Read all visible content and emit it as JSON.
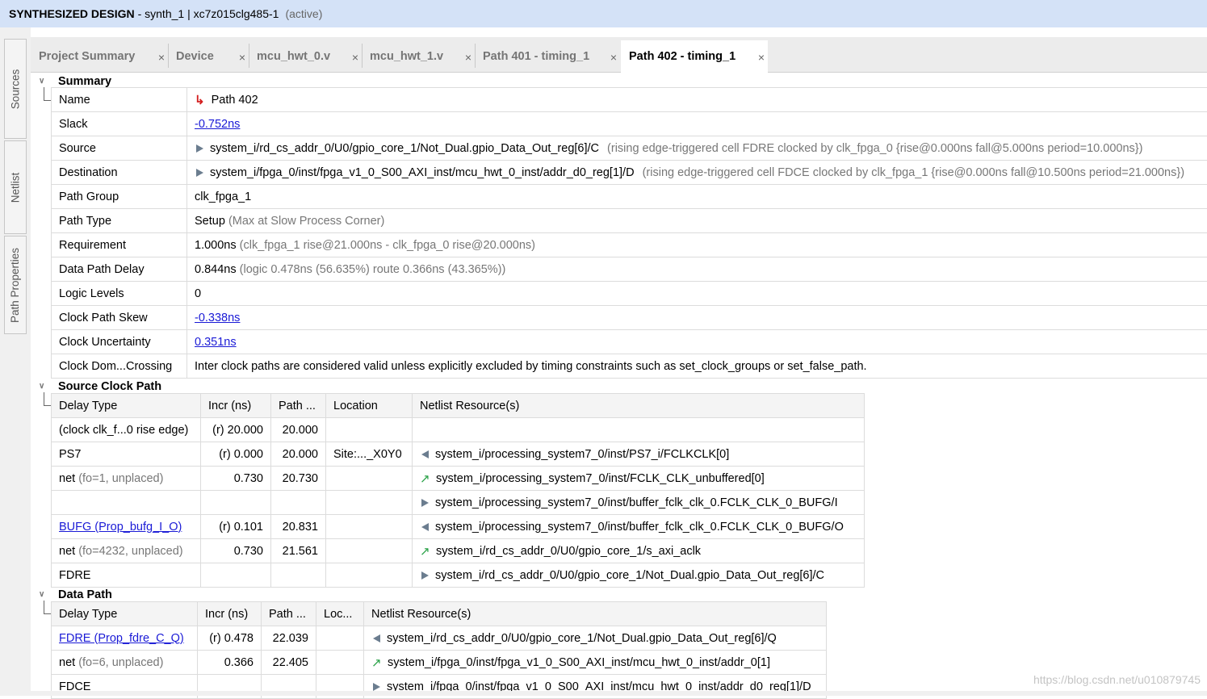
{
  "title": {
    "design": "SYNTHESIZED DESIGN",
    "detail": "- synth_1 | xc7z015clg485-1",
    "state": "(active)"
  },
  "side_tabs": [
    "Sources",
    "Netlist",
    "Path Properties"
  ],
  "tabs": [
    {
      "label": "Project Summary"
    },
    {
      "label": "Device"
    },
    {
      "label": "mcu_hwt_0.v"
    },
    {
      "label": "mcu_hwt_1.v"
    },
    {
      "label": "Path 401 - timing_1"
    },
    {
      "label": "Path 402 - timing_1"
    }
  ],
  "close_glyph": "×",
  "summary": {
    "header": "Summary",
    "name_label": "Name",
    "name_value": "Path 402",
    "slack_label": "Slack",
    "slack_value": "-0.752ns",
    "source_label": "Source",
    "source_value": "system_i/rd_cs_addr_0/U0/gpio_core_1/Not_Dual.gpio_Data_Out_reg[6]/C",
    "source_note": "(rising edge-triggered cell FDRE clocked by clk_fpga_0  {rise@0.000ns fall@5.000ns period=10.000ns})",
    "dest_label": "Destination",
    "dest_value": "system_i/fpga_0/inst/fpga_v1_0_S00_AXI_inst/mcu_hwt_0_inst/addr_d0_reg[1]/D",
    "dest_note": "(rising edge-triggered cell FDCE clocked by clk_fpga_1  {rise@0.000ns fall@10.500ns period=21.000ns})",
    "group_label": "Path Group",
    "group_value": "clk_fpga_1",
    "type_label": "Path Type",
    "type_value": "Setup",
    "type_note": "(Max at Slow Process Corner)",
    "req_label": "Requirement",
    "req_value": "1.000ns",
    "req_note": "(clk_fpga_1 rise@21.000ns - clk_fpga_0 rise@20.000ns)",
    "dpd_label": "Data Path Delay",
    "dpd_value": "0.844ns",
    "dpd_note": "(logic 0.478ns (56.635%)  route 0.366ns (43.365%))",
    "ll_label": "Logic Levels",
    "ll_value": "0",
    "skew_label": "Clock Path Skew",
    "skew_value": "-0.338ns",
    "unc_label": "Clock Uncertainty",
    "unc_value": "0.351ns",
    "cdc_label": "Clock Dom...Crossing",
    "cdc_value": "Inter clock paths are considered valid unless explicitly excluded by timing constraints such as set_clock_groups or set_false_path."
  },
  "source_clock": {
    "header": "Source Clock Path",
    "columns": [
      "Delay Type",
      "Incr (ns)",
      "Path ...",
      "Location",
      "Netlist Resource(s)"
    ],
    "rows": [
      {
        "type": "(clock clk_f...0 rise edge)",
        "note": "",
        "incr": "(r) 20.000",
        "path": "20.000",
        "loc": "",
        "res": ""
      },
      {
        "type": "PS7",
        "note": "",
        "incr": "(r) 0.000",
        "path": "20.000",
        "loc": "Site:..._X0Y0",
        "res": "system_i/processing_system7_0/inst/PS7_i/FCLKCLK[0]"
      },
      {
        "type": "net",
        "note": "(fo=1, unplaced)",
        "incr": "0.730",
        "path": "20.730",
        "loc": "",
        "res": "system_i/processing_system7_0/inst/FCLK_CLK_unbuffered[0]"
      },
      {
        "type": "",
        "note": "",
        "incr": "",
        "path": "",
        "loc": "",
        "res": "system_i/processing_system7_0/inst/buffer_fclk_clk_0.FCLK_CLK_0_BUFG/I"
      },
      {
        "type": "BUFG (Prop_bufg_I_O)",
        "note": "",
        "incr": "(r) 0.101",
        "path": "20.831",
        "loc": "",
        "res": "system_i/processing_system7_0/inst/buffer_fclk_clk_0.FCLK_CLK_0_BUFG/O"
      },
      {
        "type": "net",
        "note": "(fo=4232, unplaced)",
        "incr": "0.730",
        "path": "21.561",
        "loc": "",
        "res": "system_i/rd_cs_addr_0/U0/gpio_core_1/s_axi_aclk"
      },
      {
        "type": "FDRE",
        "note": "",
        "incr": "",
        "path": "",
        "loc": "",
        "res": "system_i/rd_cs_addr_0/U0/gpio_core_1/Not_Dual.gpio_Data_Out_reg[6]/C"
      }
    ]
  },
  "data_path": {
    "header": "Data Path",
    "columns": [
      "Delay Type",
      "Incr (ns)",
      "Path ...",
      "Loc...",
      "Netlist Resource(s)"
    ],
    "rows": [
      {
        "type": "FDRE (Prop_fdre_C_Q)",
        "note": "",
        "incr": "(r) 0.478",
        "path": "22.039",
        "loc": "",
        "res": "system_i/rd_cs_addr_0/U0/gpio_core_1/Not_Dual.gpio_Data_Out_reg[6]/Q"
      },
      {
        "type": "net",
        "note": "(fo=6, unplaced)",
        "incr": "0.366",
        "path": "22.405",
        "loc": "",
        "res": "system_i/fpga_0/inst/fpga_v1_0_S00_AXI_inst/mcu_hwt_0_inst/addr_0[1]"
      },
      {
        "type": "FDCE",
        "note": "",
        "incr": "",
        "path": "",
        "loc": "",
        "res": "system_i/fpga_0/inst/fpga_v1_0_S00_AXI_inst/mcu_hwt_0_inst/addr_d0_reg[1]/D"
      }
    ]
  },
  "watermark": "https://blog.csdn.net/u010879745",
  "icons": {
    "path": "path-icon",
    "pin_in": "pin-input-icon",
    "pin_out": "pin-output-icon",
    "net": "net-arrow-icon"
  },
  "colors": {
    "title_bg": "#d4e2f7",
    "link": "#1a1ad6",
    "path_icon": "#d42020",
    "net_icon": "#27a045"
  }
}
